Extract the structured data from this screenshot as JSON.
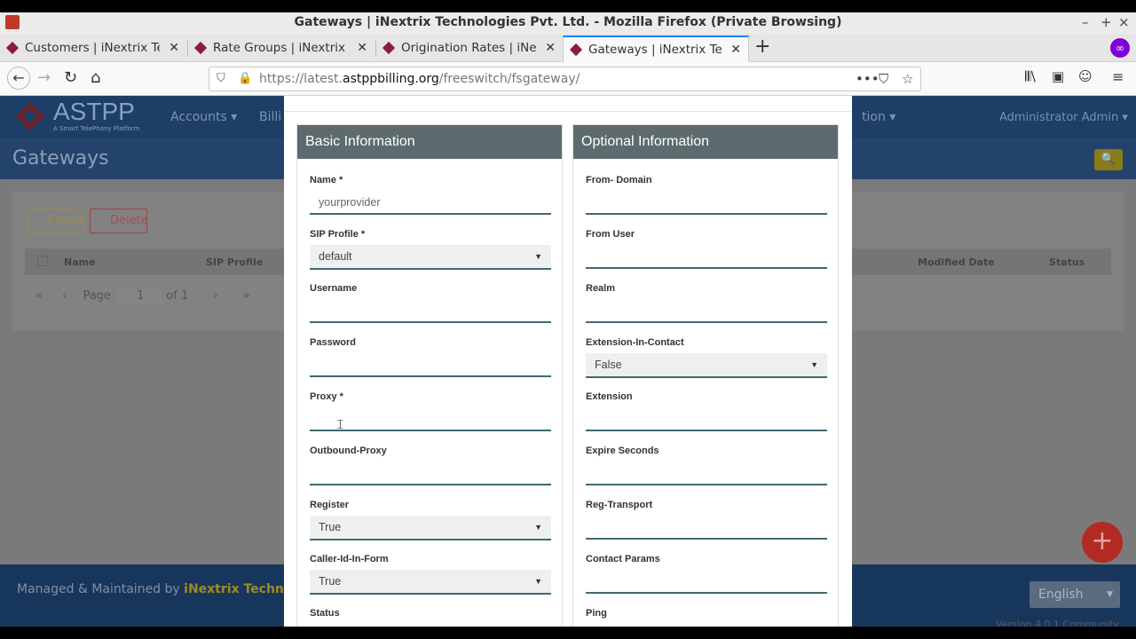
{
  "window": {
    "title": "Gateways | iNextrix Technologies Pvt. Ltd. - Mozilla Firefox (Private Browsing)",
    "controls": [
      "–",
      "+",
      "×"
    ]
  },
  "tabs": [
    {
      "label": "Customers | iNextrix Tec"
    },
    {
      "label": "Rate Groups | iNextrix Te"
    },
    {
      "label": "Origination Rates | iNext"
    },
    {
      "label": "Gateways | iNextrix Tech"
    }
  ],
  "address": {
    "prefix": "https://latest.",
    "domain": "astppbilling.org",
    "path": "/freeswitch/fsgateway/"
  },
  "app": {
    "logo_text": "ASTPP",
    "logo_sub": "A Smart TelePhony Platform",
    "menu": [
      "Accounts ▾",
      "Billi",
      "tion ▾"
    ],
    "admin": "Administrator Admin ▾",
    "page_title": "Gateways",
    "create_label": "Create",
    "delete_label": "Delete",
    "grid_headers": [
      "Name",
      "SIP Profile",
      "Modified Date",
      "Status"
    ],
    "pager": {
      "page_label": "Page",
      "page_value": "1",
      "of_label": "of 1"
    },
    "footer_prefix": "Managed & Maintained by ",
    "footer_company": "iNextrix Technolog",
    "language": "English",
    "version": "Version 4.0.1 Community"
  },
  "modal": {
    "basic": {
      "heading": "Basic Information",
      "fields": [
        {
          "label": "Name *",
          "type": "input",
          "value": "yourprovider"
        },
        {
          "label": "SIP Profile *",
          "type": "select",
          "value": "default"
        },
        {
          "label": "Username",
          "type": "input",
          "value": ""
        },
        {
          "label": "Password",
          "type": "input",
          "value": ""
        },
        {
          "label": "Proxy *",
          "type": "input",
          "value": ""
        },
        {
          "label": "Outbound-Proxy",
          "type": "input",
          "value": ""
        },
        {
          "label": "Register",
          "type": "select",
          "value": "True"
        },
        {
          "label": "Caller-Id-In-Form",
          "type": "select",
          "value": "True"
        },
        {
          "label": "Status",
          "type": "label",
          "value": ""
        }
      ]
    },
    "optional": {
      "heading": "Optional Information",
      "fields": [
        {
          "label": "From- Domain",
          "type": "input",
          "value": ""
        },
        {
          "label": "From User",
          "type": "input",
          "value": ""
        },
        {
          "label": "Realm",
          "type": "input",
          "value": ""
        },
        {
          "label": "Extension-In-Contact",
          "type": "select",
          "value": "False"
        },
        {
          "label": "Extension",
          "type": "input",
          "value": ""
        },
        {
          "label": "Expire Seconds",
          "type": "input",
          "value": ""
        },
        {
          "label": "Reg-Transport",
          "type": "input",
          "value": ""
        },
        {
          "label": "Contact Params",
          "type": "input",
          "value": ""
        },
        {
          "label": "Ping",
          "type": "label",
          "value": ""
        }
      ]
    }
  }
}
